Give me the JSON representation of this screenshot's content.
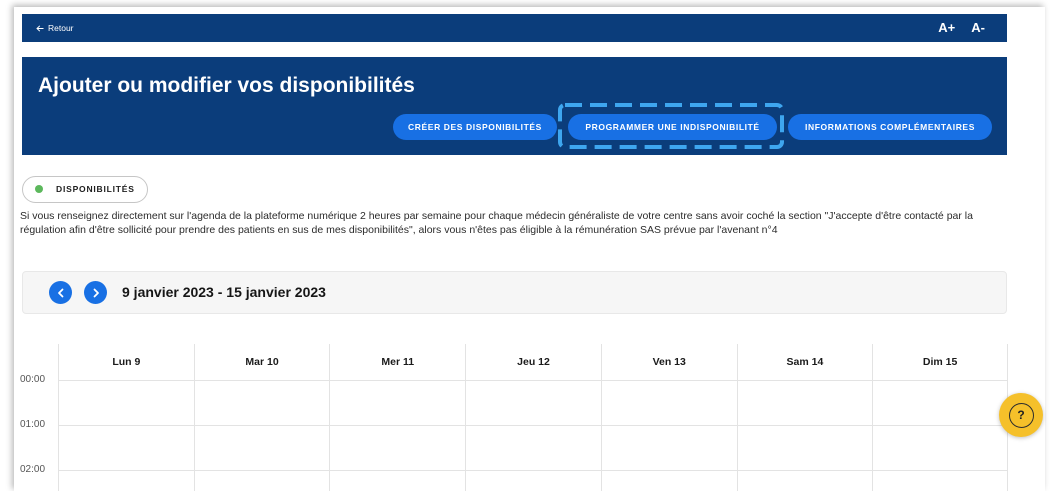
{
  "topbar": {
    "back_icon": "arrow-left-icon",
    "back_label": "Retour",
    "font_increase": "A+",
    "font_decrease": "A-"
  },
  "header": {
    "title": "Ajouter ou modifier vos disponibilités",
    "buttons": [
      {
        "label": "CRÉER DES DISPONIBILITÉS"
      },
      {
        "label": "PROGRAMMER UNE INDISPONIBILITÉ",
        "highlighted": true
      },
      {
        "label": "INFORMATIONS COMPLÉMENTAIRES"
      }
    ]
  },
  "tab": {
    "label": "DISPONIBILITÉS",
    "status_icon": "green-dot-icon"
  },
  "notice": {
    "lines": [
      "Si vous renseignez directement sur l'agenda de la plateforme numérique 2 heures par semaine pour chaque médecin généraliste de votre centre sans avoir coché la section \"J'accepte d'être contacté par la",
      "régulation afin d'être sollicité pour prendre des patients en sus de mes disponibilités\", alors vous n'êtes pas éligible à la rémunération SAS prévue par l'avenant n°4"
    ]
  },
  "week_nav": {
    "prev_icon": "chevron-left-icon",
    "next_icon": "chevron-right-icon",
    "range": "9 janvier 2023 - 15 janvier 2023"
  },
  "calendar": {
    "days": [
      "Lun 9",
      "Mar 10",
      "Mer 11",
      "Jeu 12",
      "Ven 13",
      "Sam 14",
      "Dim 15"
    ],
    "hours": [
      "00:00",
      "01:00",
      "02:00"
    ]
  },
  "help": {
    "icon": "help-icon",
    "label": "?"
  },
  "colors": {
    "header_bg": "#0b3d7b",
    "button_bg": "#1870e4",
    "highlight_outline": "#3ea6ef",
    "help_button": "#f5c02a",
    "status_dot": "#5cb85c",
    "nav_buttons": "#1870e4"
  }
}
